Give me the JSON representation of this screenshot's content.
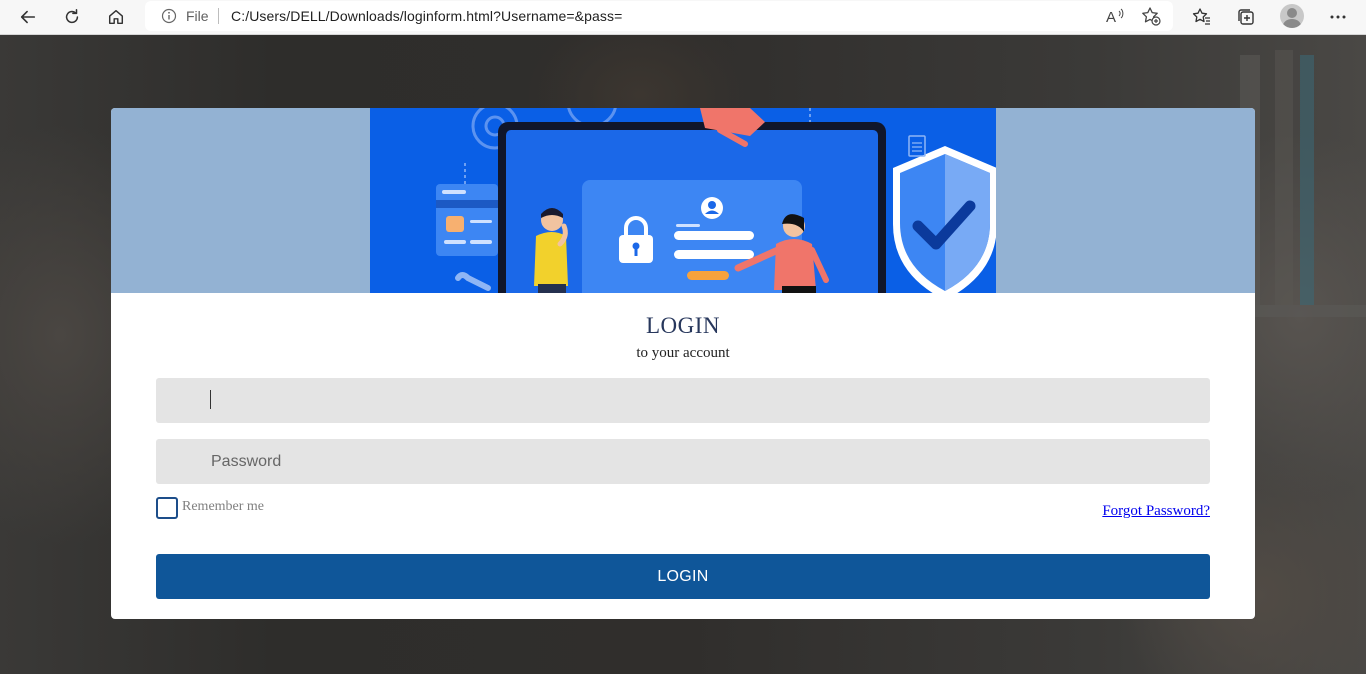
{
  "browser": {
    "address": {
      "file_label": "File",
      "url": "C:/Users/DELL/Downloads/loginform.html?Username=&pass="
    },
    "icons": [
      "back-icon",
      "refresh-icon",
      "home-icon",
      "info-icon",
      "read-aloud-icon",
      "add-favorite-icon",
      "favorites-icon",
      "collections-icon",
      "profile-avatar",
      "more-icon"
    ]
  },
  "login": {
    "title": "LOGIN",
    "subtitle": "to your account",
    "username": {
      "value": "",
      "placeholder": ""
    },
    "password": {
      "value": "",
      "placeholder": "Password"
    },
    "remember_label": "Remember me",
    "remember_checked": false,
    "forgot_label": "Forgot Password?",
    "button_label": "LOGIN"
  },
  "colors": {
    "banner": "#93b2d3",
    "illustration_bg": "#0a5fe6",
    "title": "#27375c",
    "checkbox_border": "#1d4e8a",
    "button": "#0f5699",
    "link": "#0000ee",
    "field_bg": "#e4e4e4"
  }
}
